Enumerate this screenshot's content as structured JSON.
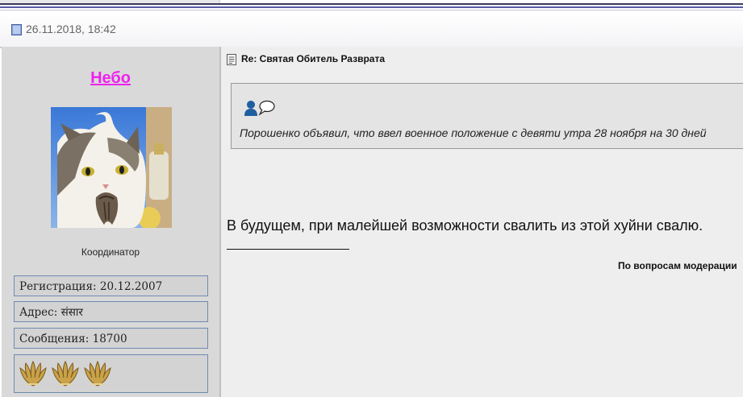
{
  "post": {
    "date": "26.11.2018, 18:42",
    "title": "Re: Святая Обитель Разврата",
    "quote_text": "Порошенко объявил, что ввел военное положение с девяти утра 28 ноября на 30 дней",
    "body": "В будущем, при малейшей возможности свалить из этой хуйни свалю.",
    "signature": "По вопросам модерации"
  },
  "author": {
    "name": "Небо",
    "role": "Координатор",
    "registration": "Регистрация: 20.12.2007",
    "address": "Адрес: संसार",
    "messages": "Сообщения: 18700",
    "award_count": 3
  },
  "icons": {
    "date_icon": "document-icon",
    "title_icon": "post-icon",
    "quote_user_icon": "user-icon",
    "quote_bubble_icon": "speech-bubble-icon",
    "award_icon": "laurel-award-icon"
  },
  "colors": {
    "username": "#ee22ee",
    "left_panel": "#d9d9d9",
    "post_panel": "#eeeeee",
    "info_border": "#6f8bb0"
  }
}
